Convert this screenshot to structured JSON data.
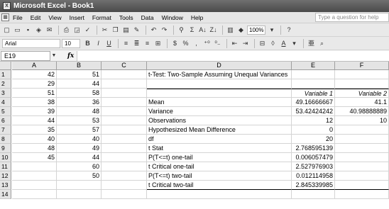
{
  "window": {
    "title": "Microsoft Excel - Book1",
    "app_icon": "X"
  },
  "menu": {
    "items": [
      "File",
      "Edit",
      "View",
      "Insert",
      "Format",
      "Tools",
      "Data",
      "Window",
      "Help"
    ],
    "help_placeholder": "Type a question for help"
  },
  "toolbar1": {
    "zoom": "100%",
    "sigma": "Σ",
    "sort_asc": "A↓",
    "sort_desc": "Z↓"
  },
  "toolbar2": {
    "font_name": "Arial",
    "font_size": "10",
    "bold": "B",
    "italic": "I",
    "underline": "U",
    "currency": "$",
    "percent": "%",
    "comma": ","
  },
  "formula_bar": {
    "name_box": "E19",
    "fx_label": "fx",
    "formula": ""
  },
  "grid": {
    "columns": [
      "A",
      "B",
      "C",
      "D",
      "E",
      "F"
    ],
    "rows": [
      "1",
      "2",
      "3",
      "4",
      "5",
      "6",
      "7",
      "8",
      "9",
      "10",
      "11",
      "12",
      "13",
      "14"
    ],
    "colA": [
      "42",
      "29",
      "51",
      "38",
      "39",
      "44",
      "35",
      "40",
      "48",
      "45",
      "",
      "",
      "",
      ""
    ],
    "colB": [
      "51",
      "44",
      "58",
      "36",
      "48",
      "53",
      "57",
      "40",
      "49",
      "44",
      "60",
      "50",
      "",
      ""
    ],
    "D1": "t-Test: Two-Sample Assuming Unequal Variances",
    "header_E": "Variable 1",
    "header_F": "Variable 2",
    "stats": [
      {
        "label": "Mean",
        "v1": "49.16666667",
        "v2": "41.1"
      },
      {
        "label": "Variance",
        "v1": "53.42424242",
        "v2": "40.98888889"
      },
      {
        "label": "Observations",
        "v1": "12",
        "v2": "10"
      },
      {
        "label": "Hypothesized Mean Difference",
        "v1": "0",
        "v2": ""
      },
      {
        "label": "df",
        "v1": "20",
        "v2": ""
      },
      {
        "label": "t Stat",
        "v1": "2.768595139",
        "v2": ""
      },
      {
        "label": "P(T<=t) one-tail",
        "v1": "0.006057479",
        "v2": ""
      },
      {
        "label": "t Critical one-tail",
        "v1": "2.527976903",
        "v2": ""
      },
      {
        "label": "P(T<=t) two-tail",
        "v1": "0.012114958",
        "v2": ""
      },
      {
        "label": "t Critical two-tail",
        "v1": "2.845339985",
        "v2": ""
      }
    ]
  }
}
